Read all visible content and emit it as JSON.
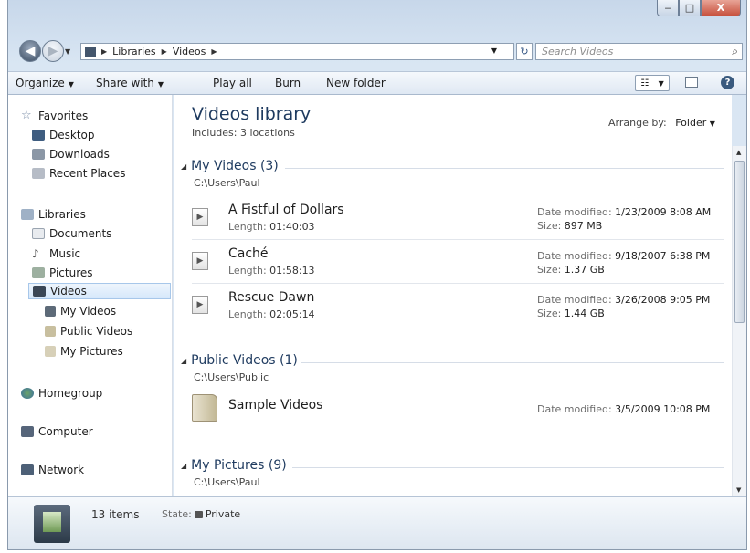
{
  "window": {
    "minimize": "‒",
    "maximize": "□",
    "close": "X"
  },
  "address": {
    "segments": [
      "Libraries",
      "Videos"
    ],
    "search_placeholder": "Search Videos"
  },
  "toolbar": {
    "organize": "Organize",
    "share_with": "Share with",
    "play_all": "Play all",
    "burn": "Burn",
    "new_folder": "New folder"
  },
  "nav": {
    "favorites": "Favorites",
    "desktop": "Desktop",
    "downloads": "Downloads",
    "recent_places": "Recent Places",
    "libraries": "Libraries",
    "documents": "Documents",
    "music": "Music",
    "pictures": "Pictures",
    "videos": "Videos",
    "my_videos": "My Videos",
    "public_videos": "Public Videos",
    "my_pictures": "My Pictures",
    "homegroup": "Homegroup",
    "computer": "Computer",
    "network": "Network"
  },
  "library": {
    "title": "Videos library",
    "includes": "Includes: 3 locations",
    "arrange_label": "Arrange by:",
    "arrange_value": "Folder"
  },
  "groups": [
    {
      "name": "My Videos (3)",
      "path": "C:\\Users\\Paul"
    },
    {
      "name": "Public Videos (1)",
      "path": "C:\\Users\\Public"
    },
    {
      "name": "My Pictures (9)",
      "path": "C:\\Users\\Paul"
    }
  ],
  "items": [
    {
      "name": "A Fistful of Dollars",
      "length_label": "Length:",
      "length": "01:40:03",
      "date_label": "Date modified:",
      "date": "1/23/2009 8:08 AM",
      "size_label": "Size:",
      "size": "897 MB"
    },
    {
      "name": "Caché",
      "length_label": "Length:",
      "length": "01:58:13",
      "date_label": "Date modified:",
      "date": "9/18/2007 6:38 PM",
      "size_label": "Size:",
      "size": "1.37 GB"
    },
    {
      "name": "Rescue Dawn",
      "length_label": "Length:",
      "length": "02:05:14",
      "date_label": "Date modified:",
      "date": "3/26/2008 9:05 PM",
      "size_label": "Size:",
      "size": "1.44 GB"
    },
    {
      "name": "Sample Videos",
      "date_label": "Date modified:",
      "date": "3/5/2009 10:08 PM"
    }
  ],
  "details": {
    "count": "13 items",
    "state_label": "State:",
    "state": "Private"
  }
}
